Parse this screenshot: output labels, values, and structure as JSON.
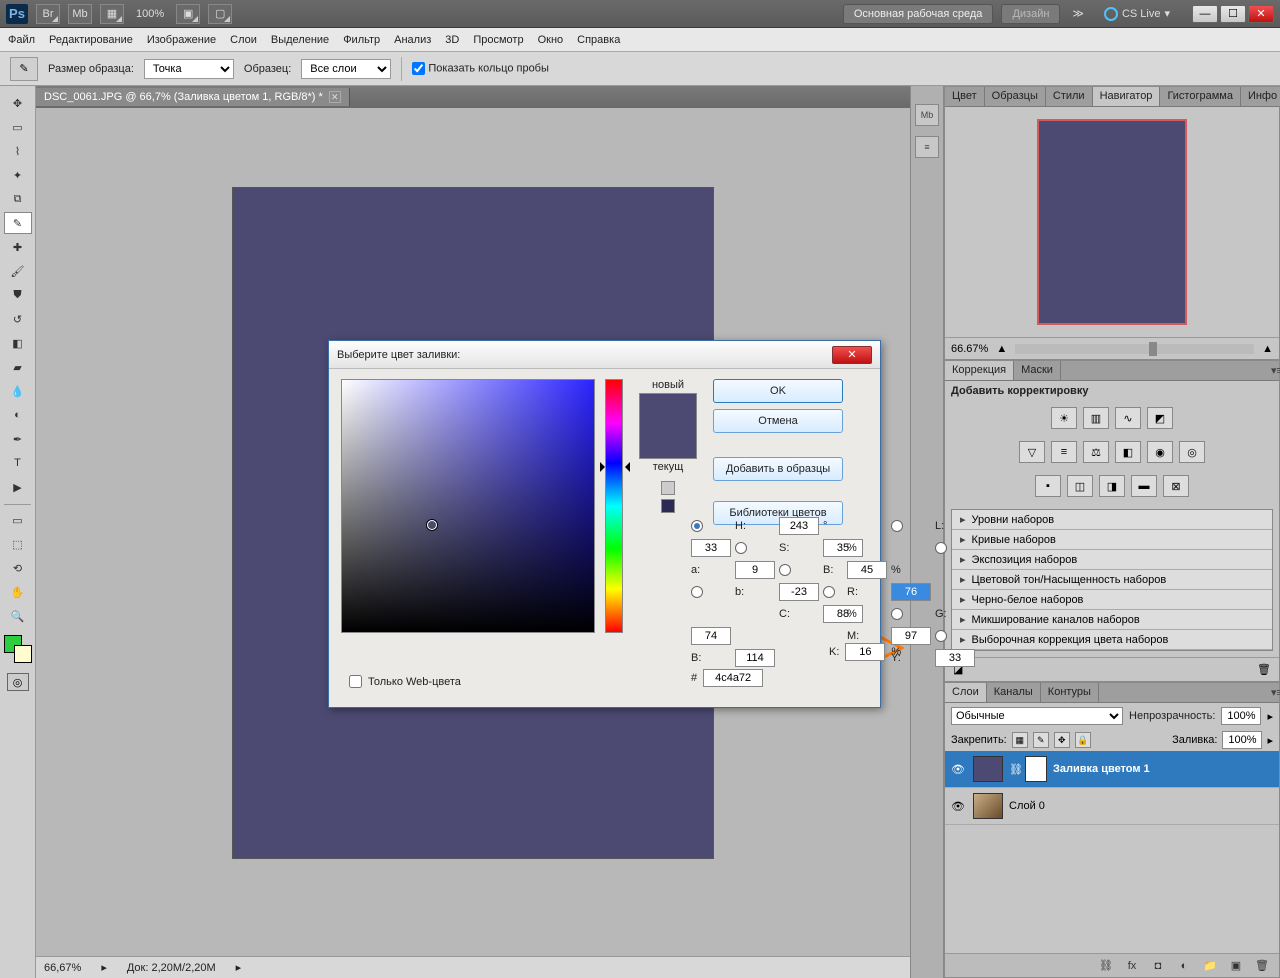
{
  "app_bar": {
    "zoom": "100%",
    "workspace_pill": "Основная рабочая среда",
    "design_pill": "Дизайн",
    "cs_live": "CS Live"
  },
  "menu": [
    "Файл",
    "Редактирование",
    "Изображение",
    "Слои",
    "Выделение",
    "Фильтр",
    "Анализ",
    "3D",
    "Просмотр",
    "Окно",
    "Справка"
  ],
  "options": {
    "sample_size_label": "Размер образца:",
    "sample_size_value": "Точка",
    "sample_label": "Образец:",
    "sample_value": "Все слои",
    "show_ring": "Показать кольцо пробы"
  },
  "doc": {
    "tab": "DSC_0061.JPG @ 66,7% (Заливка цветом 1, RGB/8*) *"
  },
  "status": {
    "zoom": "66,67%",
    "doc_info": "Док: 2,20M/2,20M"
  },
  "navigator": {
    "tabs": [
      "Цвет",
      "Образцы",
      "Стили",
      "Навигатор",
      "Гистограмма",
      "Инфо"
    ],
    "zoom": "66.67%"
  },
  "adjustments": {
    "tabs": [
      "Коррекция",
      "Маски"
    ],
    "title": "Добавить корректировку",
    "presets": [
      "Уровни наборов",
      "Кривые наборов",
      "Экспозиция наборов",
      "Цветовой тон/Насыщенность наборов",
      "Черно-белое наборов",
      "Микширование каналов наборов",
      "Выборочная коррекция цвета наборов"
    ]
  },
  "layers": {
    "tabs": [
      "Слои",
      "Каналы",
      "Контуры"
    ],
    "blend_mode": "Обычные",
    "opacity_label": "Непрозрачность:",
    "opacity": "100%",
    "lock_label": "Закрепить:",
    "fill_label": "Заливка:",
    "fill": "100%",
    "items": [
      {
        "name": "Заливка цветом 1",
        "selected": true,
        "has_mask": true
      },
      {
        "name": "Слой 0",
        "selected": false,
        "has_mask": false
      }
    ]
  },
  "picker": {
    "title": "Выберите цвет заливки:",
    "new_label": "новый",
    "current_label": "текущ",
    "ok": "OK",
    "cancel": "Отмена",
    "add_swatch": "Добавить в образцы",
    "libraries": "Библиотеки цветов",
    "H": "243",
    "S": "35",
    "B": "45",
    "R": "76",
    "G": "74",
    "Bb": "114",
    "L": "33",
    "a": "9",
    "b": "-23",
    "C": "88",
    "M": "97",
    "Y": "33",
    "K": "16",
    "hex": "4c4a72",
    "web_only": "Только Web-цвета"
  }
}
